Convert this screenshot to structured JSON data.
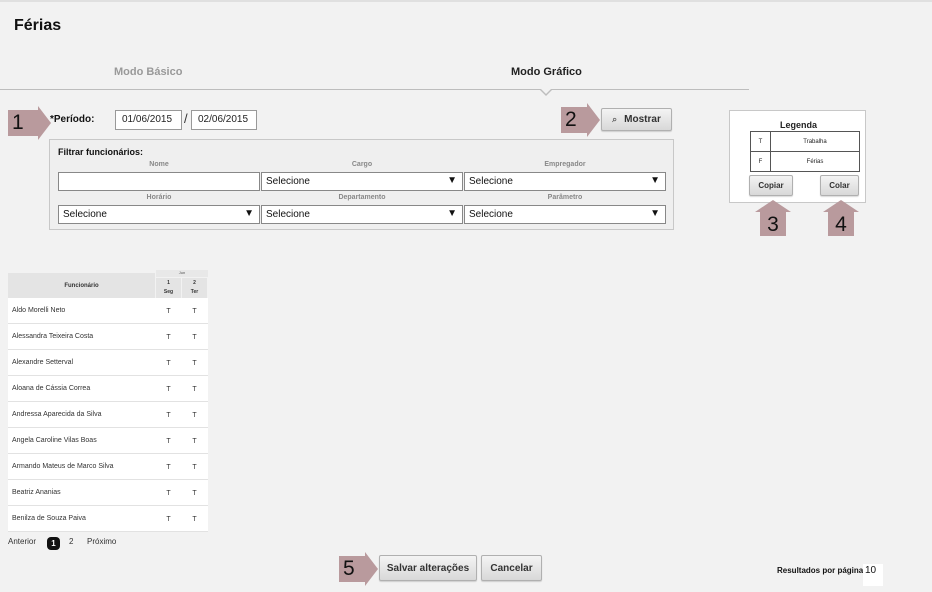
{
  "page": {
    "title": "Férias"
  },
  "tabs": [
    {
      "label": "Modo Básico",
      "active": false
    },
    {
      "label": "Modo Gráfico",
      "active": true
    }
  ],
  "markers": [
    "1",
    "2",
    "3",
    "4",
    "5"
  ],
  "period": {
    "label": "*Período:",
    "start": "01/06/2015",
    "separator": "/",
    "end": "02/06/2015"
  },
  "buttons": {
    "show": "Mostrar",
    "copy": "Copiar",
    "paste": "Colar",
    "save": "Salvar alterações",
    "cancel": "Cancelar"
  },
  "filters": {
    "title": "Filtrar funcionários:",
    "fields": [
      {
        "label": "Nome",
        "value": ""
      },
      {
        "label": "Cargo",
        "value": "Selecione"
      },
      {
        "label": "Empregador",
        "value": "Selecione"
      },
      {
        "label": "Horário",
        "value": "Selecione"
      },
      {
        "label": "Departamento",
        "value": "Selecione"
      },
      {
        "label": "Parâmetro",
        "value": "Selecione"
      }
    ]
  },
  "legend": {
    "title": "Legenda",
    "items": [
      {
        "code": "T",
        "label": "Trabalha"
      },
      {
        "code": "F",
        "label": "Férias"
      }
    ]
  },
  "grid": {
    "name_header": "Funcionário",
    "month_header": "Jun",
    "days": [
      {
        "day": "1",
        "weekday": "Seg"
      },
      {
        "day": "2",
        "weekday": "Ter"
      }
    ],
    "rows": [
      {
        "name": "Aldo Morelli Neto",
        "cells": [
          "T",
          "T"
        ]
      },
      {
        "name": "Alessandra Teixeira Costa",
        "cells": [
          "T",
          "T"
        ]
      },
      {
        "name": "Alexandre Setterval",
        "cells": [
          "T",
          "T"
        ]
      },
      {
        "name": "Aloana de Cássia Correa",
        "cells": [
          "T",
          "T"
        ]
      },
      {
        "name": "Andressa Aparecida da Silva",
        "cells": [
          "T",
          "T"
        ]
      },
      {
        "name": "Angela Caroline Vilas Boas",
        "cells": [
          "T",
          "T"
        ]
      },
      {
        "name": "Armando Mateus de Marco Silva",
        "cells": [
          "T",
          "T"
        ]
      },
      {
        "name": "Beatriz Ananias",
        "cells": [
          "T",
          "T"
        ]
      },
      {
        "name": "Benilza de Souza Paiva",
        "cells": [
          "T",
          "T"
        ]
      }
    ]
  },
  "pagination": {
    "prev": "Anterior",
    "current": "1",
    "next_page": "2",
    "next": "Próximo"
  },
  "results_per_page": {
    "label": "Resultados por página:",
    "value": "10"
  },
  "colors": {
    "marker": "#b99a9d",
    "background": "#f2f2f2",
    "panel": "#efefef",
    "current_page": "#111111"
  }
}
